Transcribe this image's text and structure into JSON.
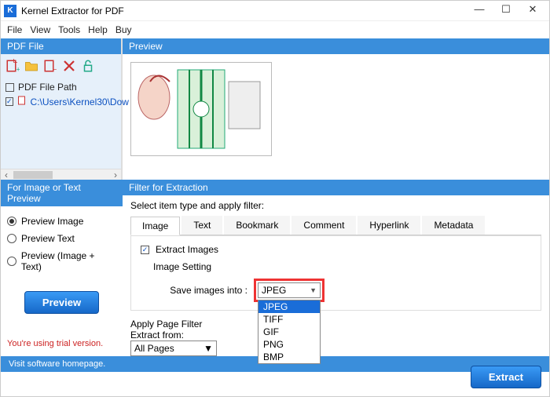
{
  "app": {
    "title": "Kernel Extractor for PDF",
    "iconLetter": "K"
  },
  "menu": {
    "file": "File",
    "view": "View",
    "tools": "Tools",
    "help": "Help",
    "buy": "Buy"
  },
  "left": {
    "head": "PDF File",
    "pathHeader": "PDF File Path",
    "file1": "C:\\Users\\Kernel30\\Dow"
  },
  "preview": {
    "head": "Preview"
  },
  "previewOpts": {
    "head": "For Image or Text Preview",
    "r1": "Preview Image",
    "r2": "Preview Text",
    "r3": "Preview (Image + Text)",
    "btn": "Preview",
    "trial": "You're using trial version."
  },
  "filter": {
    "head": "Filter for Extraction",
    "prompt": "Select item type and apply filter:",
    "tabs": {
      "image": "Image",
      "text": "Text",
      "bookmark": "Bookmark",
      "comment": "Comment",
      "hyperlink": "Hyperlink",
      "metadata": "Metadata"
    },
    "extractImages": "Extract Images",
    "imageSetting": "Image Setting",
    "saveInto": "Save images into :",
    "selected": "JPEG",
    "opts": {
      "jpeg": "JPEG",
      "tiff": "TIFF",
      "gif": "GIF",
      "png": "PNG",
      "bmp": "BMP"
    },
    "applyPage": "Apply Page Filter",
    "extractFrom": "Extract from:",
    "allPages": "All Pages",
    "extractBtn": "Extract"
  },
  "status": "Visit software homepage."
}
